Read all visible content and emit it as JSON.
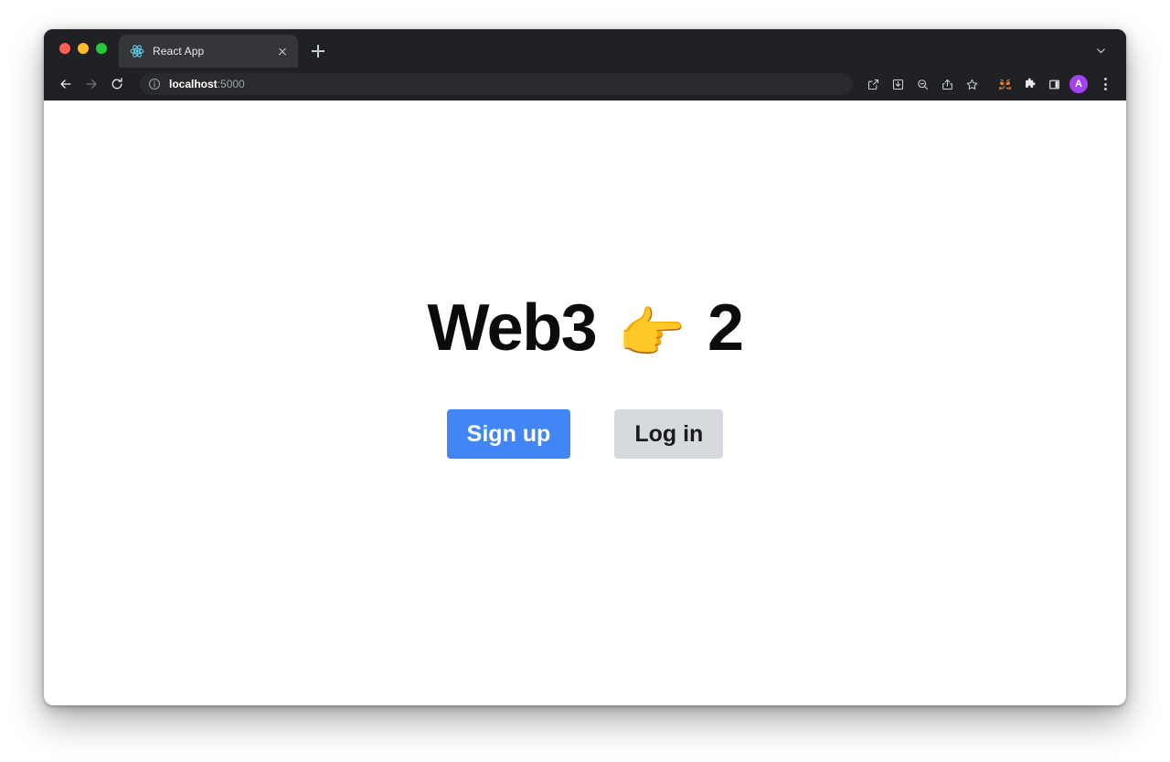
{
  "browser": {
    "window_controls": [
      {
        "name": "close",
        "color": "#ff5f57"
      },
      {
        "name": "minimize",
        "color": "#febc2e"
      },
      {
        "name": "maximize",
        "color": "#28c840"
      }
    ],
    "tabs": [
      {
        "title": "React App",
        "favicon": "react-logo",
        "active": true
      }
    ],
    "new_tab_label": "+",
    "tabstrip_chevron": "chevron-down-icon",
    "nav": {
      "back": "back-arrow-icon",
      "forward": "forward-arrow-icon",
      "reload": "reload-icon"
    },
    "omnibox": {
      "info_icon": "site-info-icon",
      "host": "localhost",
      "port": ":5000",
      "full_url": "localhost:5000"
    },
    "toolbar_icons": [
      {
        "name": "open-in-new-icon"
      },
      {
        "name": "install-download-icon"
      },
      {
        "name": "zoom-out-icon"
      },
      {
        "name": "share-icon"
      },
      {
        "name": "bookmark-star-icon"
      },
      {
        "name": "metamask-fox-icon"
      },
      {
        "name": "extensions-puzzle-icon"
      },
      {
        "name": "side-panel-icon"
      }
    ],
    "profile": {
      "initial": "A",
      "color": "#a142f4"
    },
    "menu": "three-dot-menu-icon"
  },
  "page": {
    "title_prefix": "Web3 ",
    "title_emoji": "👉",
    "title_suffix": " 2",
    "buttons": {
      "signup_label": "Sign up",
      "login_label": "Log in",
      "signup_color": "#4285f4",
      "login_color": "#d6d9de"
    }
  }
}
